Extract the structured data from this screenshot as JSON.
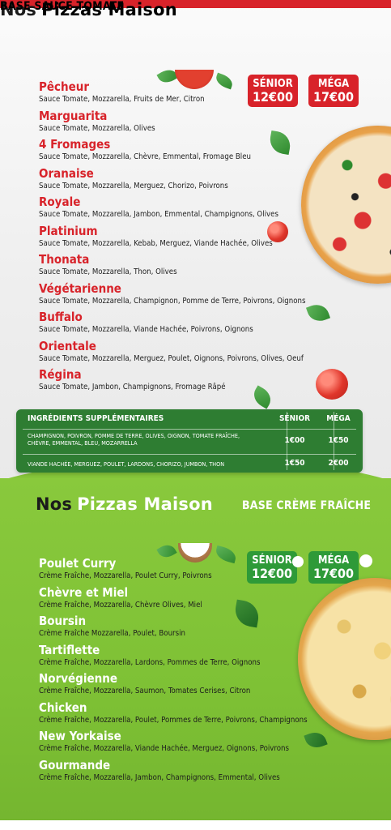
{
  "colors": {
    "red": "#d8232a",
    "green_dark": "#2e7d32",
    "green_light": "#86c73a",
    "white": "#ffffff"
  },
  "tomato_section": {
    "title_word1": "Nos",
    "title_word2": "Pizzas Maison",
    "base": "BASE SAUCE TOMATE",
    "prices": {
      "senior_label": "SÉNIOR",
      "senior_value": "12€00",
      "mega_label": "MÉGA",
      "mega_value": "17€00"
    },
    "items": [
      {
        "name": "Pêcheur",
        "desc": "Sauce Tomate, Mozzarella, Fruits de Mer, Citron"
      },
      {
        "name": "Marguarita",
        "desc": "Sauce Tomate, Mozzarella, Olives"
      },
      {
        "name": "4 Fromages",
        "desc": "Sauce Tomate, Mozzarella, Chèvre, Emmental, Fromage Bleu"
      },
      {
        "name": "Oranaise",
        "desc": "Sauce Tomate, Mozzarella, Merguez, Chorizo, Poivrons"
      },
      {
        "name": "Royale",
        "desc": "Sauce Tomate, Mozzarella, Jambon, Emmental, Champignons, Olives"
      },
      {
        "name": "Platinium",
        "desc": "Sauce Tomate, Mozzarella, Kebab, Merguez, Viande Hachée, Olives"
      },
      {
        "name": "Thonata",
        "desc": "Sauce Tomate, Mozzarella, Thon, Olives"
      },
      {
        "name": "Végétarienne",
        "desc": "Sauce Tomate, Mozzarella, Champignon, Pomme de Terre, Poivrons, Oignons"
      },
      {
        "name": "Buffalo",
        "desc": "Sauce Tomate, Mozzarella, Viande Hachée, Poivrons, Oignons"
      },
      {
        "name": "Orientale",
        "desc": "Sauce Tomate, Mozzarella, Merguez, Poulet, Oignons, Poivrons, Olives, Oeuf"
      },
      {
        "name": "Régina",
        "desc": "Sauce Tomate, Jambon, Champignons, Fromage Râpé"
      }
    ]
  },
  "extras": {
    "header": "INGRÉDIENTS SUPPLÉMENTAIRES",
    "col_senior": "SÉNIOR",
    "col_mega": "MÉGA",
    "rows": [
      {
        "line1": "CHAMPIGNON, POIVRON, POMME DE TERRE, OLIVES, OIGNON,  TOMATE FRAÎCHE,",
        "line2": "CHÈVRE, EMMENTAL, BLEU, MOZARRELLA",
        "senior": "1€00",
        "mega": "1€50"
      },
      {
        "line1": "VIANDE HACHÉE, MERGUEZ, POULET, LARDONS, CHORIZO, JUMBON, THON",
        "line2": "",
        "senior": "1€50",
        "mega": "2€00"
      }
    ]
  },
  "cream_section": {
    "title_word1": "Nos",
    "title_word2": "Pizzas Maison",
    "base": "BASE CRÈME FRAÎCHE",
    "prices": {
      "senior_label": "SÉNIOR",
      "senior_value": "12€00",
      "mega_label": "MÉGA",
      "mega_value": "17€00"
    },
    "items": [
      {
        "name": "Poulet Curry",
        "desc": "Crème Fraîche, Mozzarella, Poulet Curry, Poivrons"
      },
      {
        "name": "Chèvre et Miel",
        "desc": "Crème Fraîche, Mozzarella, Chèvre Olives, Miel"
      },
      {
        "name": "Boursin",
        "desc": "Crème Fraîche Mozzarella, Poulet, Boursin"
      },
      {
        "name": "Tartiflette",
        "desc": "Crème Fraîche, Mozzarella, Lardons, Pommes de Terre, Oignons"
      },
      {
        "name": "Norvégienne",
        "desc": "Crème Fraîche, Mozzarella, Saumon, Tomates Cerises, Citron"
      },
      {
        "name": "Chicken",
        "desc": "Crème Fraîche, Mozzarella, Poulet, Pommes de Terre, Poivrons, Champignons"
      },
      {
        "name": "New Yorkaise",
        "desc": "Crème Fraîche, Mozzarella, Viande Hachée, Merguez, Oignons, Poivrons"
      },
      {
        "name": "Gourmande",
        "desc": "Crème Fraîche, Mozzarella, Jambon, Champignons, Emmental, Olives"
      }
    ]
  }
}
